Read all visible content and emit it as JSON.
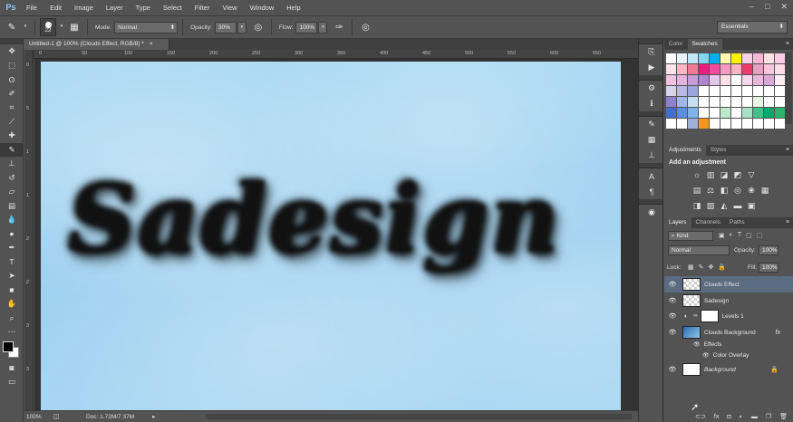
{
  "app": {
    "logo": "Ps"
  },
  "menu": [
    "File",
    "Edit",
    "Image",
    "Layer",
    "Type",
    "Select",
    "Filter",
    "View",
    "Window",
    "Help"
  ],
  "window_controls": [
    "–",
    "□",
    "✕"
  ],
  "options_bar": {
    "brush_size": "22",
    "mode_label": "Mode:",
    "mode_value": "Normal",
    "opacity_label": "Opacity:",
    "opacity_value": "30%",
    "flow_label": "Flow:",
    "flow_value": "100%",
    "workspace": "Essentials"
  },
  "document_tab": {
    "title": "Untitled-1 @ 100% (Clouds Effect, RGB/8) *",
    "close": "×"
  },
  "rulers": {
    "top_ticks": [
      "0",
      "50",
      "100",
      "150",
      "200",
      "250",
      "300",
      "350",
      "400",
      "450",
      "500",
      "550",
      "600",
      "650"
    ],
    "left_ticks": [
      "0",
      "5",
      "1",
      "1",
      "2",
      "2",
      "3",
      "3"
    ]
  },
  "canvas": {
    "text": "Sadesign"
  },
  "statusbar": {
    "zoom": "100%",
    "doc": "Doc: 1.72M/7.37M",
    "arrow": "▸"
  },
  "swatches_panel": {
    "tabs": [
      "Color",
      "Swatches"
    ],
    "active_tab": "Swatches",
    "colors": [
      "#ffffff",
      "#e8f4fb",
      "#bfe9f7",
      "#7fd7f2",
      "#00aeef",
      "#fff6b0",
      "#fff200",
      "#fbd0e6",
      "#f9b5d5",
      "#fde2e4",
      "#ffcce6",
      "#ffe2ec",
      "#ffb7c5",
      "#f07b96",
      "#ed1c7e",
      "#ee4aa0",
      "#f49ac1",
      "#fbb4c4",
      "#ee3b6b",
      "#e8a0c0",
      "#f6c6dd",
      "#ffdde9",
      "#f2c3e0",
      "#e3b1df",
      "#c89cd8",
      "#b283d1",
      "#e2c8ea",
      "#ffe0e6",
      "#ffffff",
      "#f5d7ec",
      "#e9b8dc",
      "#d9a8d8",
      "#fff0f5",
      "#d7d2ee",
      "#b9b7e6",
      "#9ba6de",
      "#ffffff",
      "#ffffff",
      "#ffffff",
      "#ffffff",
      "#ffffff",
      "#ffffff",
      "#ffffff",
      "#ffffff",
      "#8d7fd1",
      "#9fb4e7",
      "#c8dff2",
      "#ffffff",
      "#ffffff",
      "#ffffff",
      "#ffffff",
      "#ffffff",
      "#e9f5e4",
      "#ffffff",
      "#ffffff",
      "#3f6fd1",
      "#5a8ee0",
      "#7fb3ea",
      "#ffffff",
      "#ffffff",
      "#bde8c9",
      "#ffffff",
      "#a8e0c8",
      "#40c28a",
      "#00a86b",
      "#2db36b",
      "#ffffff",
      "#ffffff",
      "#9fb0d9",
      "#f7941d",
      "#ffffff",
      "#ffffff",
      "#ffffff",
      "#ffffff",
      "#ffffff",
      "#ffffff",
      "#ffffff"
    ]
  },
  "adjustments_panel": {
    "tabs": [
      "Adjustments",
      "Styles"
    ],
    "active_tab": "Adjustments",
    "title": "Add an adjustment"
  },
  "layers_panel": {
    "tabs": [
      "Layers",
      "Channels",
      "Paths"
    ],
    "active_tab": "Layers",
    "kind_filter": "Kind",
    "blend_mode": "Normal",
    "opacity_label": "Opacity:",
    "opacity_value": "100%",
    "lock_label": "Lock:",
    "fill_label": "Fill:",
    "fill_value": "100%",
    "layers": [
      {
        "name": "Clouds Effect",
        "selected": true
      },
      {
        "name": "Sadesign",
        "selected": false
      },
      {
        "name": "Levels 1",
        "selected": false
      },
      {
        "name": "Clouds Background",
        "selected": false,
        "fx": "fx"
      },
      {
        "name": "Effects",
        "sub": true
      },
      {
        "name": "Color Overlay",
        "sub": true
      },
      {
        "name": "Background",
        "selected": false,
        "locked": true
      }
    ],
    "bottom_icons": [
      "link-icon",
      "fx-icon",
      "mask-icon",
      "adjustment-icon",
      "group-icon",
      "new-layer-icon",
      "trash-icon"
    ]
  },
  "colors": {
    "ui_bg": "#535353",
    "canvas_sky": "#a9d8f3",
    "selected_layer": "#5b6b80"
  }
}
